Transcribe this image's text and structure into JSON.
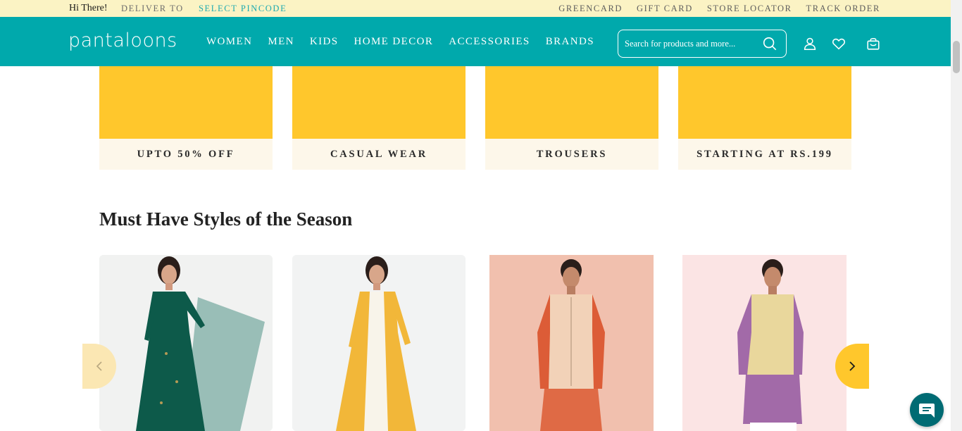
{
  "topbar": {
    "greeting": "Hi There!",
    "deliver_to": "DELIVER TO",
    "pincode_link": "SELECT PINCODE",
    "links": [
      "GREENCARD",
      "GIFT CARD",
      "STORE LOCATOR",
      "TRACK ORDER"
    ]
  },
  "header": {
    "logo": "pantaloons",
    "nav": [
      "WOMEN",
      "MEN",
      "KIDS",
      "HOME DECOR",
      "ACCESSORIES",
      "BRANDS"
    ],
    "search_placeholder": "Search for products and more...",
    "icons": [
      "search-icon",
      "user-icon",
      "heart-icon",
      "bag-icon"
    ]
  },
  "categories": [
    {
      "label": "UPTO 50% OFF"
    },
    {
      "label": "CASUAL WEAR"
    },
    {
      "label": "TROUSERS"
    },
    {
      "label": "STARTING AT RS.199"
    }
  ],
  "section": {
    "title": "Must Have Styles of the Season"
  },
  "colors": {
    "teal": "#00a9ac",
    "topbar_bg": "#fbf3c4",
    "accent_yellow": "#ffc72c",
    "chat": "#006b73"
  }
}
